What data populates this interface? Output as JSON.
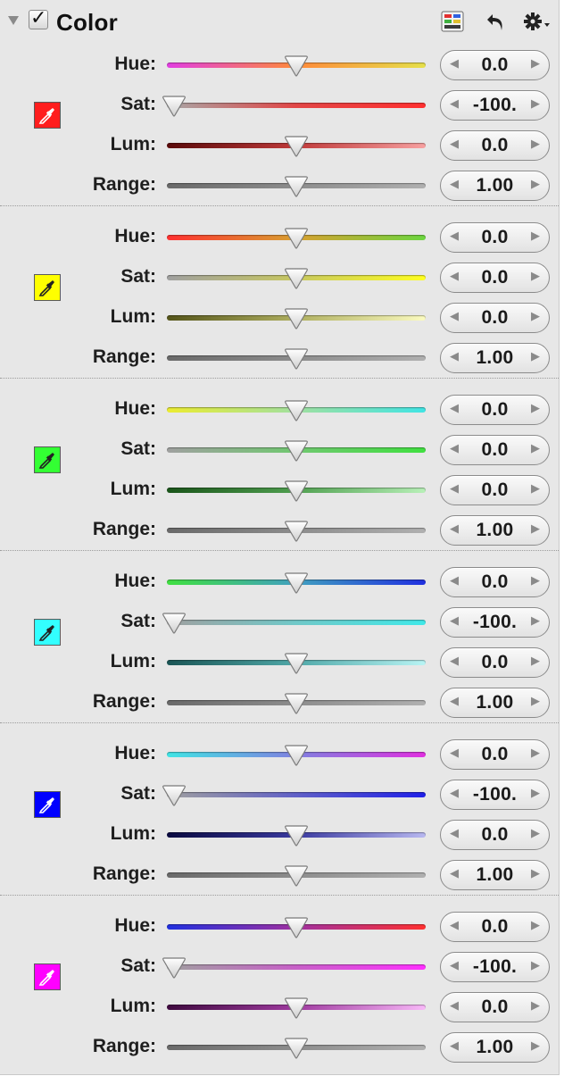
{
  "header": {
    "title": "Color",
    "enabled": true,
    "icons": [
      "disclosure-triangle-icon",
      "checkbox-icon",
      "presets-icon",
      "undo-icon",
      "gear-menu-icon"
    ]
  },
  "row_labels": [
    "Hue:",
    "Sat:",
    "Lum:",
    "Range:"
  ],
  "sections": [
    {
      "name": "red",
      "swatch": "#ff1e1e",
      "dropper": "#ffffff",
      "hue": {
        "value": "0.0",
        "pos": 0.5,
        "grad": [
          "#e23ee2",
          "#ff8a3a",
          "#e6e04a"
        ]
      },
      "sat": {
        "value": "-100.",
        "pos": 0.0,
        "grad": [
          "#a8a8a8",
          "#e24646",
          "#ff3030"
        ]
      },
      "lum": {
        "value": "0.0",
        "pos": 0.5,
        "grad": [
          "#5a0a0a",
          "#c03a3a",
          "#f7a0a0"
        ]
      },
      "range": {
        "value": "1.00",
        "pos": 0.5,
        "grad": [
          "#6a6a6a",
          "#8d8d8d",
          "#b0b0b0"
        ]
      }
    },
    {
      "name": "yellow",
      "swatch": "#ffff00",
      "dropper": "#222222",
      "hue": {
        "value": "0.0",
        "pos": 0.5,
        "grad": [
          "#ff3030",
          "#d8a030",
          "#6cd640"
        ]
      },
      "sat": {
        "value": "0.0",
        "pos": 0.5,
        "grad": [
          "#a0a0a0",
          "#c8c860",
          "#ffff20"
        ]
      },
      "lum": {
        "value": "0.0",
        "pos": 0.5,
        "grad": [
          "#55551a",
          "#b0b060",
          "#fbfbc0"
        ]
      },
      "range": {
        "value": "1.00",
        "pos": 0.5,
        "grad": [
          "#6a6a6a",
          "#8d8d8d",
          "#b0b0b0"
        ]
      }
    },
    {
      "name": "green",
      "swatch": "#33ff33",
      "dropper": "#222222",
      "hue": {
        "value": "0.0",
        "pos": 0.5,
        "grad": [
          "#ecec30",
          "#a0e0a0",
          "#40e4e4"
        ]
      },
      "sat": {
        "value": "0.0",
        "pos": 0.5,
        "grad": [
          "#a0a0a0",
          "#70c870",
          "#40e040"
        ]
      },
      "lum": {
        "value": "0.0",
        "pos": 0.5,
        "grad": [
          "#1a551a",
          "#50a050",
          "#b8f0b8"
        ]
      },
      "range": {
        "value": "1.00",
        "pos": 0.5,
        "grad": [
          "#6a6a6a",
          "#8d8d8d",
          "#b0b0b0"
        ]
      }
    },
    {
      "name": "cyan",
      "swatch": "#33ffff",
      "dropper": "#222222",
      "hue": {
        "value": "0.0",
        "pos": 0.5,
        "grad": [
          "#40e040",
          "#40a0c0",
          "#2030e0"
        ]
      },
      "sat": {
        "value": "-100.",
        "pos": 0.0,
        "grad": [
          "#a0a0a0",
          "#70c8c8",
          "#40e8e8"
        ]
      },
      "lum": {
        "value": "0.0",
        "pos": 0.5,
        "grad": [
          "#1a5555",
          "#50a8a8",
          "#b8f4f4"
        ]
      },
      "range": {
        "value": "1.00",
        "pos": 0.5,
        "grad": [
          "#6a6a6a",
          "#8d8d8d",
          "#b0b0b0"
        ]
      }
    },
    {
      "name": "blue",
      "swatch": "#0000ff",
      "dropper": "#ffffff",
      "hue": {
        "value": "0.0",
        "pos": 0.5,
        "grad": [
          "#40e4e4",
          "#8080e0",
          "#e030e0"
        ]
      },
      "sat": {
        "value": "-100.",
        "pos": 0.0,
        "grad": [
          "#a0a0a0",
          "#6060c8",
          "#2020e8"
        ]
      },
      "lum": {
        "value": "0.0",
        "pos": 0.5,
        "grad": [
          "#0a0a40",
          "#3a3aa0",
          "#b8b8f0"
        ]
      },
      "range": {
        "value": "1.00",
        "pos": 0.5,
        "grad": [
          "#6a6a6a",
          "#8d8d8d",
          "#b0b0b0"
        ]
      }
    },
    {
      "name": "magenta",
      "swatch": "#ff00ff",
      "dropper": "#ffffff",
      "hue": {
        "value": "0.0",
        "pos": 0.5,
        "grad": [
          "#2030e0",
          "#a030a0",
          "#ff3030"
        ]
      },
      "sat": {
        "value": "-100.",
        "pos": 0.0,
        "grad": [
          "#a0a0a0",
          "#c860c8",
          "#ff30ff"
        ]
      },
      "lum": {
        "value": "0.0",
        "pos": 0.5,
        "grad": [
          "#400a40",
          "#a03aa0",
          "#f8b8f8"
        ]
      },
      "range": {
        "value": "1.00",
        "pos": 0.5,
        "grad": [
          "#6a6a6a",
          "#8d8d8d",
          "#b0b0b0"
        ]
      }
    }
  ]
}
